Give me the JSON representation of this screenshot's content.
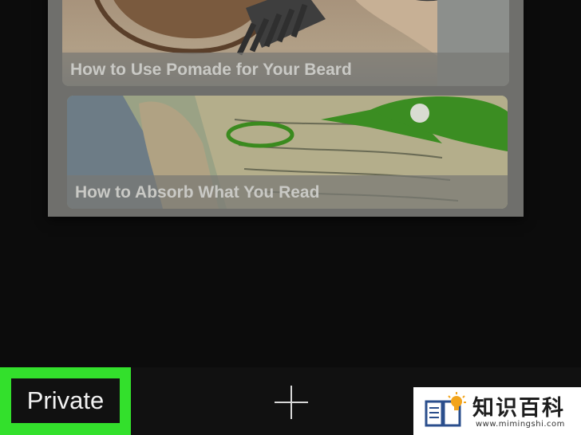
{
  "tab_switcher": {
    "articles": [
      {
        "title": "How to Use Pomade for Your Beard"
      },
      {
        "title": "How to Absorb What You Read"
      }
    ]
  },
  "toolbar": {
    "private_label": "Private",
    "new_tab_icon": "plus-icon",
    "highlight_color": "#33e02c"
  },
  "watermark": {
    "title": "知识百科",
    "url": "www.mimingshi.com"
  }
}
